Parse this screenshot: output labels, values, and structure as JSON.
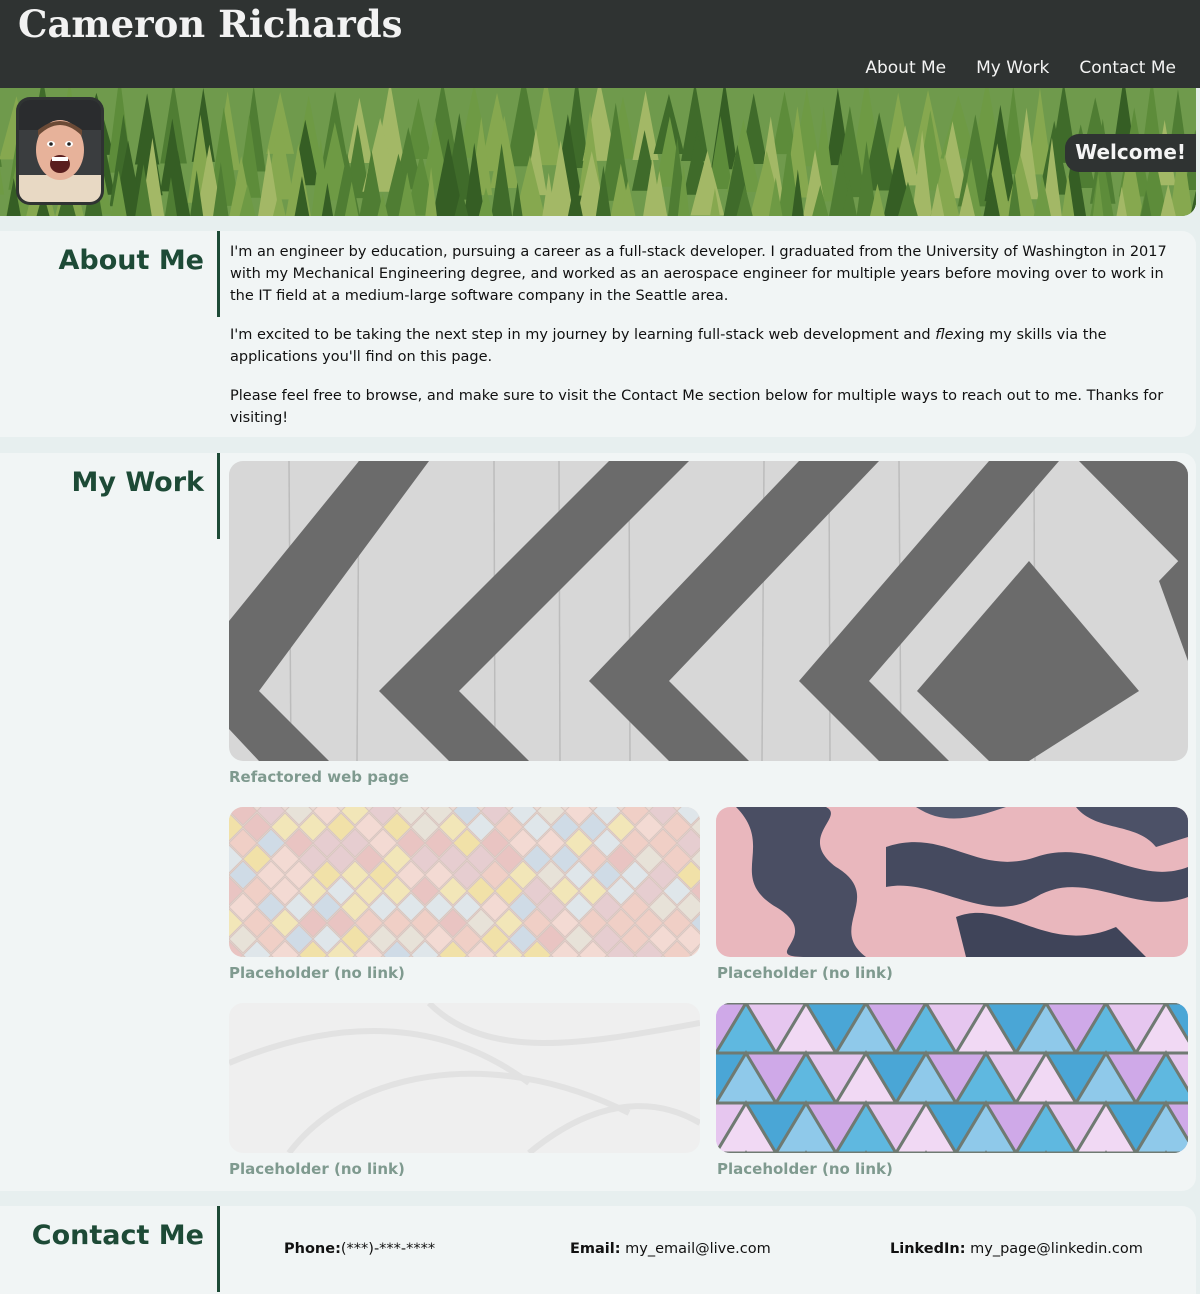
{
  "header": {
    "title": "Cameron Richards",
    "nav": [
      "About Me",
      "My Work",
      "Contact Me"
    ]
  },
  "hero": {
    "welcome": "Welcome!"
  },
  "about": {
    "title": "About Me",
    "paragraphs": [
      "I'm an engineer by education, pursuing a career as a full-stack developer. I graduated from the University of Washington in 2017 with my Mechanical Engineering degree, and worked as an aerospace engineer for multiple years before moving over to work in the IT field at a medium-large software company in the Seattle area.",
      "Please feel free to browse, and make sure to visit the Contact Me section below for multiple ways to reach out to me. Thanks for visiting!"
    ],
    "p2_before": "I'm excited to be taking the next step in my journey by learning full-stack web development and ",
    "p2_em": "flex",
    "p2_after": "ing my skills via the applications you'll find on this page."
  },
  "work": {
    "title": "My Work",
    "featured_caption": "Refactored web page",
    "captions": [
      "Placeholder (no link)",
      "Placeholder (no link)",
      "Placeholder (no link)",
      "Placeholder (no link)"
    ]
  },
  "contact": {
    "title": "Contact Me",
    "phone_label": "Phone:",
    "phone_value": "(***)-***-****",
    "email_label": "Email:",
    "email_value": " my_email@live.com",
    "linkedin_label": "LinkedIn:",
    "linkedin_value": " my_page@linkedin.com"
  },
  "colors": {
    "header_bg": "#2f3332",
    "accent": "#1d4a36",
    "caption": "#7f9a8f",
    "section_bg": "#f1f5f5",
    "page_bg": "#e7efef"
  }
}
